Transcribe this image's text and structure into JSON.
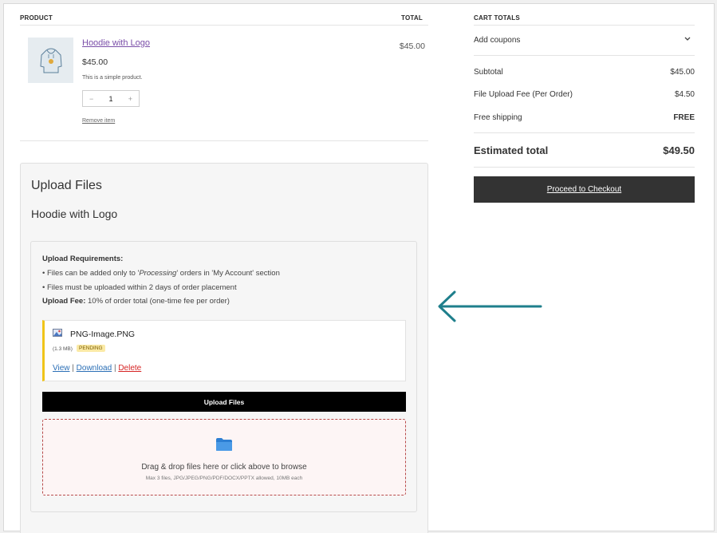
{
  "table": {
    "product_header": "PRODUCT",
    "total_header": "TOTAL"
  },
  "item": {
    "name": "Hoodie with Logo",
    "price": "$45.00",
    "description": "This is a simple product.",
    "quantity": "1",
    "qty_minus": "−",
    "qty_plus": "+",
    "remove_label": "Remove item",
    "line_total": "$45.00"
  },
  "upload": {
    "title": "Upload Files",
    "product_name": "Hoodie with Logo",
    "requirements_title": "Upload Requirements:",
    "rule1_prefix": "• Files can be added only to '",
    "rule1_em": "Processing",
    "rule1_suffix": "' orders in 'My Account' section",
    "rule2": "• Files must be uploaded within 2 days of order placement",
    "fee_label": "Upload Fee:",
    "fee_text": " 10% of order total (one-time fee per order)",
    "file": {
      "name": "PNG-Image.PNG",
      "size": "(1.3 MB)",
      "status": "PENDING",
      "view": "View",
      "download": "Download",
      "delete": "Delete",
      "sep": "|"
    },
    "button_label": "Upload Files",
    "dropzone_text": "Drag & drop files here or click above to browse",
    "dropzone_note": "Max 3 files, JPG/JPEG/PNG/PDF/DOCX/PPTX allowed, 10MB each"
  },
  "cart_totals": {
    "header": "CART TOTALS",
    "coupons_label": "Add coupons",
    "subtotal_label": "Subtotal",
    "subtotal_value": "$45.00",
    "fee_label": "File Upload Fee (Per Order)",
    "fee_value": "$4.50",
    "shipping_label": "Free shipping",
    "shipping_value": "FREE",
    "estimated_label": "Estimated total",
    "estimated_value": "$49.50",
    "checkout_label": "Proceed to Checkout"
  },
  "colors": {
    "accent_arrow": "#1f7f8c",
    "pending_badge": "#fbeaa6",
    "delete_link": "#d62424",
    "product_link": "#7a4ea8"
  }
}
